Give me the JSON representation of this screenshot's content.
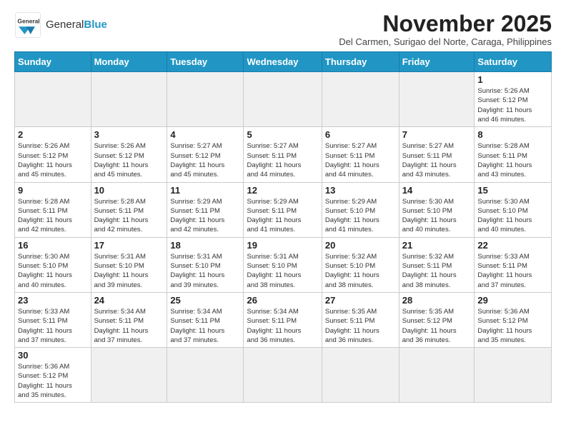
{
  "header": {
    "logo_text_general": "General",
    "logo_text_blue": "Blue",
    "title": "November 2025",
    "subtitle": "Del Carmen, Surigao del Norte, Caraga, Philippines"
  },
  "days_of_week": [
    "Sunday",
    "Monday",
    "Tuesday",
    "Wednesday",
    "Thursday",
    "Friday",
    "Saturday"
  ],
  "weeks": [
    [
      {
        "day": "",
        "info": ""
      },
      {
        "day": "",
        "info": ""
      },
      {
        "day": "",
        "info": ""
      },
      {
        "day": "",
        "info": ""
      },
      {
        "day": "",
        "info": ""
      },
      {
        "day": "",
        "info": ""
      },
      {
        "day": "1",
        "info": "Sunrise: 5:26 AM\nSunset: 5:12 PM\nDaylight: 11 hours\nand 46 minutes."
      }
    ],
    [
      {
        "day": "2",
        "info": "Sunrise: 5:26 AM\nSunset: 5:12 PM\nDaylight: 11 hours\nand 45 minutes."
      },
      {
        "day": "3",
        "info": "Sunrise: 5:26 AM\nSunset: 5:12 PM\nDaylight: 11 hours\nand 45 minutes."
      },
      {
        "day": "4",
        "info": "Sunrise: 5:27 AM\nSunset: 5:12 PM\nDaylight: 11 hours\nand 45 minutes."
      },
      {
        "day": "5",
        "info": "Sunrise: 5:27 AM\nSunset: 5:11 PM\nDaylight: 11 hours\nand 44 minutes."
      },
      {
        "day": "6",
        "info": "Sunrise: 5:27 AM\nSunset: 5:11 PM\nDaylight: 11 hours\nand 44 minutes."
      },
      {
        "day": "7",
        "info": "Sunrise: 5:27 AM\nSunset: 5:11 PM\nDaylight: 11 hours\nand 43 minutes."
      },
      {
        "day": "8",
        "info": "Sunrise: 5:28 AM\nSunset: 5:11 PM\nDaylight: 11 hours\nand 43 minutes."
      }
    ],
    [
      {
        "day": "9",
        "info": "Sunrise: 5:28 AM\nSunset: 5:11 PM\nDaylight: 11 hours\nand 42 minutes."
      },
      {
        "day": "10",
        "info": "Sunrise: 5:28 AM\nSunset: 5:11 PM\nDaylight: 11 hours\nand 42 minutes."
      },
      {
        "day": "11",
        "info": "Sunrise: 5:29 AM\nSunset: 5:11 PM\nDaylight: 11 hours\nand 42 minutes."
      },
      {
        "day": "12",
        "info": "Sunrise: 5:29 AM\nSunset: 5:11 PM\nDaylight: 11 hours\nand 41 minutes."
      },
      {
        "day": "13",
        "info": "Sunrise: 5:29 AM\nSunset: 5:10 PM\nDaylight: 11 hours\nand 41 minutes."
      },
      {
        "day": "14",
        "info": "Sunrise: 5:30 AM\nSunset: 5:10 PM\nDaylight: 11 hours\nand 40 minutes."
      },
      {
        "day": "15",
        "info": "Sunrise: 5:30 AM\nSunset: 5:10 PM\nDaylight: 11 hours\nand 40 minutes."
      }
    ],
    [
      {
        "day": "16",
        "info": "Sunrise: 5:30 AM\nSunset: 5:10 PM\nDaylight: 11 hours\nand 40 minutes."
      },
      {
        "day": "17",
        "info": "Sunrise: 5:31 AM\nSunset: 5:10 PM\nDaylight: 11 hours\nand 39 minutes."
      },
      {
        "day": "18",
        "info": "Sunrise: 5:31 AM\nSunset: 5:10 PM\nDaylight: 11 hours\nand 39 minutes."
      },
      {
        "day": "19",
        "info": "Sunrise: 5:31 AM\nSunset: 5:10 PM\nDaylight: 11 hours\nand 38 minutes."
      },
      {
        "day": "20",
        "info": "Sunrise: 5:32 AM\nSunset: 5:10 PM\nDaylight: 11 hours\nand 38 minutes."
      },
      {
        "day": "21",
        "info": "Sunrise: 5:32 AM\nSunset: 5:11 PM\nDaylight: 11 hours\nand 38 minutes."
      },
      {
        "day": "22",
        "info": "Sunrise: 5:33 AM\nSunset: 5:11 PM\nDaylight: 11 hours\nand 37 minutes."
      }
    ],
    [
      {
        "day": "23",
        "info": "Sunrise: 5:33 AM\nSunset: 5:11 PM\nDaylight: 11 hours\nand 37 minutes."
      },
      {
        "day": "24",
        "info": "Sunrise: 5:34 AM\nSunset: 5:11 PM\nDaylight: 11 hours\nand 37 minutes."
      },
      {
        "day": "25",
        "info": "Sunrise: 5:34 AM\nSunset: 5:11 PM\nDaylight: 11 hours\nand 37 minutes."
      },
      {
        "day": "26",
        "info": "Sunrise: 5:34 AM\nSunset: 5:11 PM\nDaylight: 11 hours\nand 36 minutes."
      },
      {
        "day": "27",
        "info": "Sunrise: 5:35 AM\nSunset: 5:11 PM\nDaylight: 11 hours\nand 36 minutes."
      },
      {
        "day": "28",
        "info": "Sunrise: 5:35 AM\nSunset: 5:12 PM\nDaylight: 11 hours\nand 36 minutes."
      },
      {
        "day": "29",
        "info": "Sunrise: 5:36 AM\nSunset: 5:12 PM\nDaylight: 11 hours\nand 35 minutes."
      }
    ],
    [
      {
        "day": "30",
        "info": "Sunrise: 5:36 AM\nSunset: 5:12 PM\nDaylight: 11 hours\nand 35 minutes."
      },
      {
        "day": "",
        "info": ""
      },
      {
        "day": "",
        "info": ""
      },
      {
        "day": "",
        "info": ""
      },
      {
        "day": "",
        "info": ""
      },
      {
        "day": "",
        "info": ""
      },
      {
        "day": "",
        "info": ""
      }
    ]
  ]
}
